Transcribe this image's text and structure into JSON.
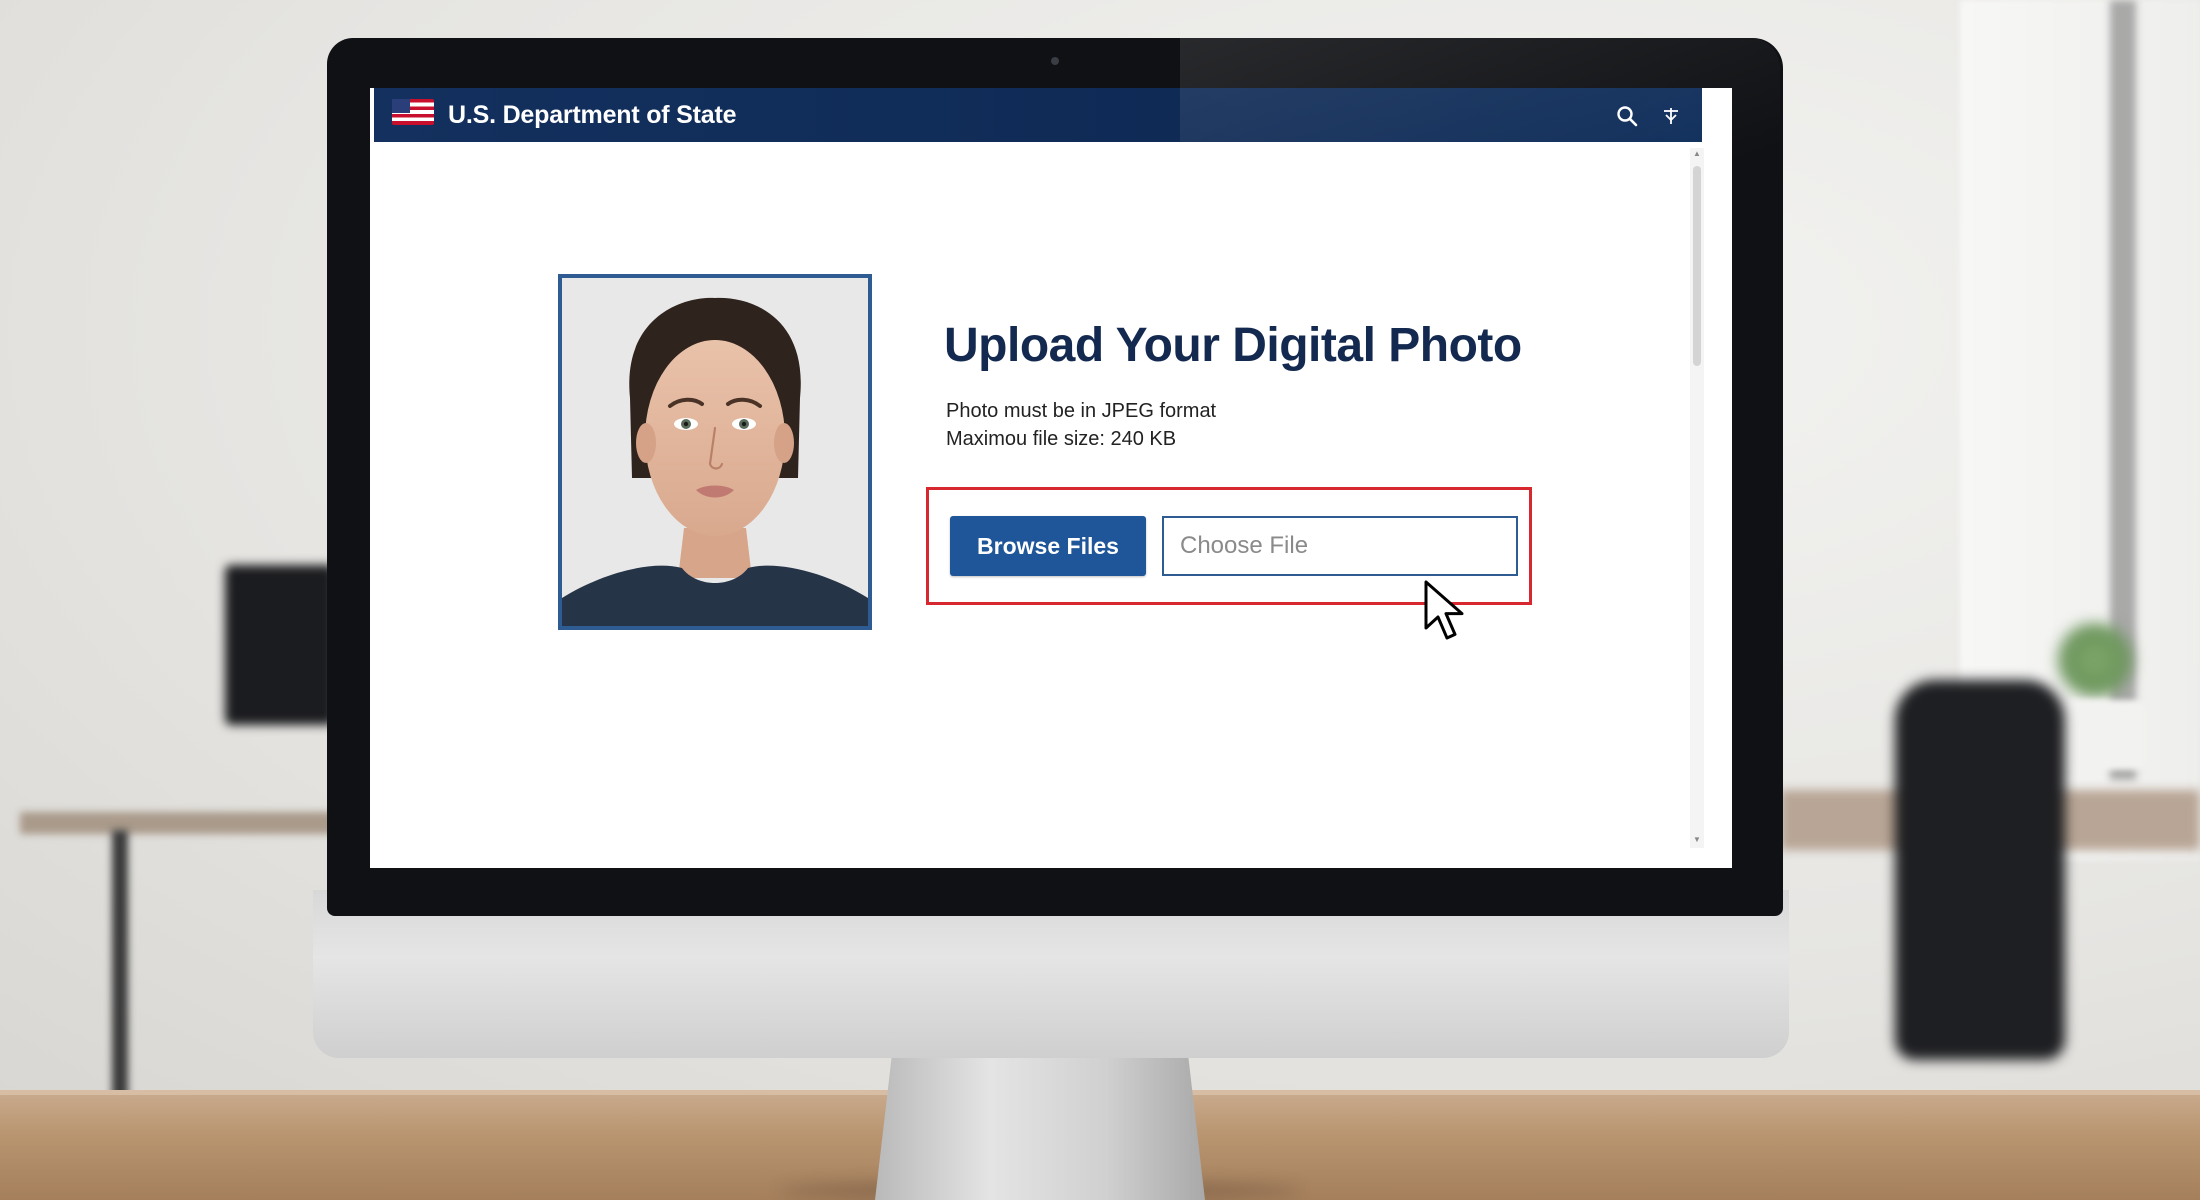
{
  "browser": {
    "agency_name": "U.S. Department of State"
  },
  "page": {
    "heading": "Upload Your Digital Photo",
    "requirements": [
      "Photo must be in JPEG format",
      "Maximou file size: 240 KB"
    ]
  },
  "upload": {
    "browse_label": "Browse Files",
    "file_placeholder": "Choose File",
    "highlight_color": "#d7282f"
  },
  "colors": {
    "header_bg": "#0f2a55",
    "heading_text": "#13294f",
    "button_bg": "#1f5599",
    "frame_border": "#2f5b93"
  },
  "icons": {
    "header_left": "us-flag-icon",
    "header_right": [
      "search-icon",
      "language-icon"
    ],
    "pointer": "mouse-cursor-icon"
  }
}
